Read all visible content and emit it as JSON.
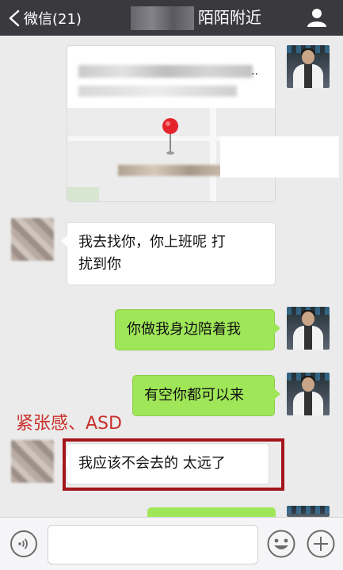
{
  "header": {
    "back_label": "微信(21)",
    "title": "陌陌附近"
  },
  "map_card": {
    "ellipsis": ".."
  },
  "messages": [
    {
      "side": "left",
      "text": "我去找你，你上班呢  打\n扰到你"
    },
    {
      "side": "right",
      "text": "你做我身边陪着我"
    },
    {
      "side": "right",
      "text": "有空你都可以来"
    },
    {
      "side": "left",
      "text": "我应该不会去的  太远了"
    }
  ],
  "annotation": "紧张感、ASD",
  "input": {
    "value": "",
    "placeholder": ""
  },
  "colors": {
    "header_bg": "#3a3a3e",
    "chat_bg": "#ebebeb",
    "sent_bubble": "#9fe658",
    "received_bubble": "#ffffff",
    "annotation_text": "#c9302c",
    "highlight_border": "#a3151b",
    "map_pin": "#e3252b"
  },
  "icons": {
    "back": "chevron-left-icon",
    "profile": "person-icon",
    "voice": "voice-icon",
    "emoji": "emoji-icon",
    "more": "plus-icon",
    "location": "map-pin-icon"
  }
}
